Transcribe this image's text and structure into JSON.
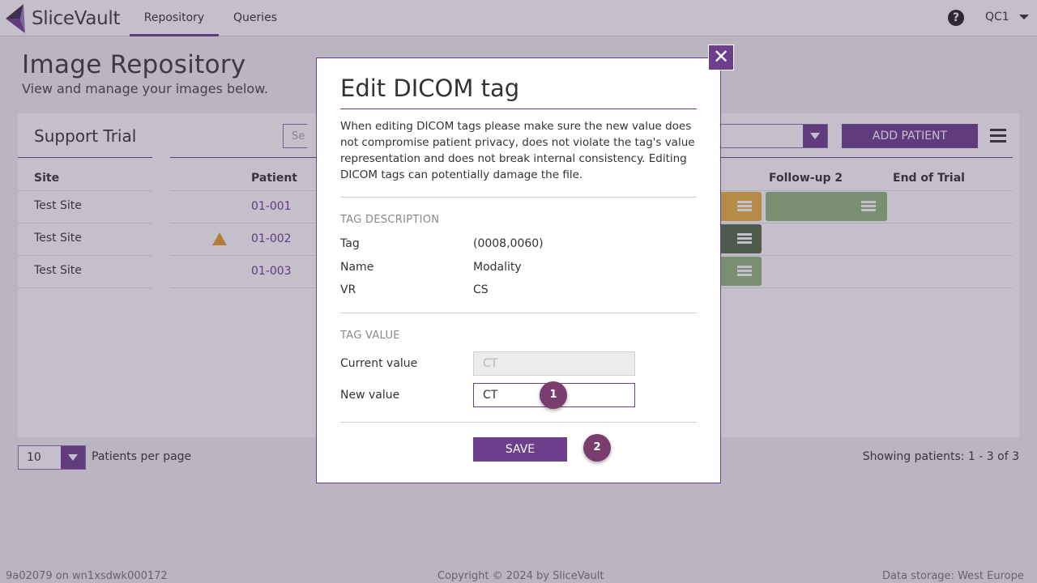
{
  "app": {
    "name": "SliceVault"
  },
  "nav": {
    "tabs": [
      {
        "label": "Repository",
        "active": true
      },
      {
        "label": "Queries",
        "active": false
      }
    ],
    "user": "QC1"
  },
  "page": {
    "title": "Image Repository",
    "subtitle": "View and manage your images below."
  },
  "card": {
    "trial_name": "Support Trial",
    "search_placeholder": "Se",
    "add_patient_label": "ADD PATIENT",
    "columns": {
      "site": "Site",
      "patient": "Patient",
      "followup2": "Follow-up 2",
      "end_of_trial": "End of Trial"
    },
    "rows": [
      {
        "site": "Test Site",
        "patient": "01-001",
        "warning": false
      },
      {
        "site": "Test Site",
        "patient": "01-002",
        "warning": true
      },
      {
        "site": "Test Site",
        "patient": "01-003",
        "warning": false
      }
    ]
  },
  "footer": {
    "per_page_value": "10",
    "per_page_label": "Patients per page",
    "showing": "Showing patients: 1 - 3 of 3",
    "build": "9a02079 on wn1xsdwk000172",
    "copyright": "Copyright © 2024 by SliceVault",
    "storage": "Data storage: West Europe"
  },
  "modal": {
    "title": "Edit DICOM tag",
    "description": "When editing DICOM tags please make sure the new value does not compromise patient privacy, does not violate the tag's value representation and does not break internal consistency. Editing DICOM tags can potentially damage the file.",
    "tag_description_label": "TAG DESCRIPTION",
    "tag_label": "Tag",
    "tag_value": "(0008,0060)",
    "name_label": "Name",
    "name_value": "Modality",
    "vr_label": "VR",
    "vr_value": "CS",
    "tag_value_label": "TAG VALUE",
    "current_value_label": "Current value",
    "current_value": "CT",
    "new_value_label": "New value",
    "new_value": "CT",
    "save_label": "SAVE",
    "step1": "1",
    "step2": "2"
  },
  "colors": {
    "accent": "#6b3f8c",
    "badge": "#7a3d6e",
    "visit_yellow": "#e8b43c",
    "visit_green": "#8fb87a",
    "visit_dark_green": "#4f6b45"
  },
  "icons": {
    "close": "close-icon",
    "help": "help-icon",
    "menu": "hamburger-menu-icon",
    "list": "list-icon",
    "warning": "warning-icon"
  }
}
